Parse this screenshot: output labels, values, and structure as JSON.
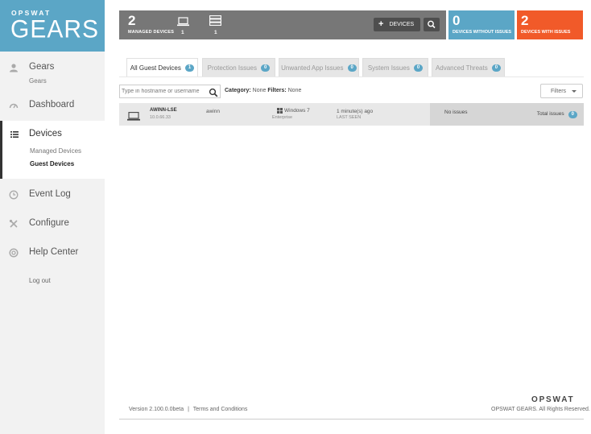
{
  "brand": {
    "top": "OPSWAT",
    "main": "GEARS"
  },
  "sidebar": {
    "gears": {
      "label": "Gears",
      "sub": "Gears"
    },
    "dashboard": {
      "label": "Dashboard"
    },
    "devices": {
      "label": "Devices",
      "sub": [
        "Managed Devices",
        "Guest Devices"
      ]
    },
    "event_log": {
      "label": "Event Log"
    },
    "configure": {
      "label": "Configure"
    },
    "help_center": {
      "label": "Help Center"
    },
    "logout": {
      "label": "Log out"
    }
  },
  "stats": {
    "managed_count": "2",
    "managed_caption": "MANAGED DEVICES",
    "laptop_count": "1",
    "server_count": "1",
    "add_devices_label": "DEVICES",
    "without_issues_count": "0",
    "without_issues_caption": "DEVICES WITHOUT ISSUES",
    "with_issues_count": "2",
    "with_issues_caption": "DEVICES WITH ISSUES"
  },
  "tabs": [
    {
      "label": "All Guest Devices",
      "count": "1"
    },
    {
      "label": "Protection Issues",
      "count": "0"
    },
    {
      "label": "Unwanted App Issues",
      "count": "0"
    },
    {
      "label": "System Issues",
      "count": "0"
    },
    {
      "label": "Advanced Threats",
      "count": "0"
    }
  ],
  "search": {
    "placeholder": "Type in hostname or username"
  },
  "filter_info": {
    "category_label": "Category:",
    "category_value": "None",
    "filters_label": "Filters:",
    "filters_value": "None"
  },
  "filters_button": "Filters",
  "device": {
    "name": "AWINN-LSE",
    "ip": "10.0.66.33",
    "user": "awinn",
    "os": "Windows 7",
    "edition": "Enterprise",
    "last_seen": "1 minute(s) ago",
    "last_seen_caption": "LAST SEEN",
    "issues_status": "No issues",
    "total_issues_label": "Total issues",
    "total_issues_count": "0"
  },
  "footer": {
    "version": "Version 2.100.0.0beta",
    "separator": "|",
    "terms": "Terms and Conditions",
    "brand": "OPSWAT",
    "rights": "OPSWAT GEARS. All Rights Reserved."
  },
  "colors": {
    "accent": "#5ba6c6",
    "alert": "#f15a29",
    "bar": "#777777"
  }
}
